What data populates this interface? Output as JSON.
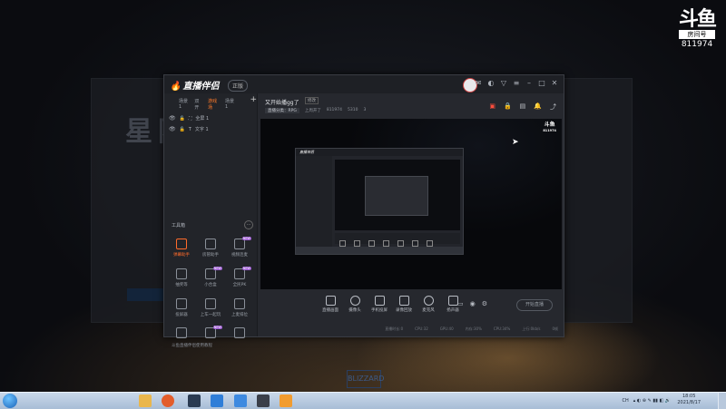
{
  "watermark": {
    "logo": "斗鱼",
    "sub": "房间号",
    "room_id": "811974"
  },
  "desktop": {
    "ghost_title": "星际",
    "blizzard_logo": "BLIZZARD"
  },
  "app": {
    "brand": "直播伴侣",
    "version_badge": "正版",
    "scene_tabs": [
      "场景1",
      "双开",
      "游戏场",
      "场景1"
    ],
    "active_scene": "游戏场",
    "sources": [
      {
        "name": "全屏 1"
      },
      {
        "name": "文字 1"
      }
    ],
    "tools_title": "工具箱",
    "tools": [
      {
        "label": "弹幕助手",
        "icon": "chat-bubble-icon",
        "active": true
      },
      {
        "label": "房管助手",
        "icon": "user-icon",
        "active": false
      },
      {
        "label": "视频连麦",
        "icon": "video-link-icon",
        "active": false,
        "tag": "NEW"
      },
      {
        "label": "抽奖等",
        "icon": "gift-icon",
        "active": false
      },
      {
        "label": "小合盒",
        "icon": "box-icon",
        "active": false,
        "tag": "NEW"
      },
      {
        "label": "全民PK",
        "icon": "pk-shield-icon",
        "active": false,
        "tag": "NEW"
      },
      {
        "label": "投屏器",
        "icon": "cast-icon",
        "active": false
      },
      {
        "label": "上车一起玩",
        "icon": "car-icon",
        "active": false
      },
      {
        "label": "上麦排位",
        "icon": "rank-icon",
        "active": false
      },
      {
        "label": "",
        "icon": "download-icon",
        "active": false
      },
      {
        "label": "",
        "icon": "music-icon",
        "active": false,
        "tag": "NEW"
      },
      {
        "label": "",
        "icon": "stats-icon",
        "active": false
      }
    ],
    "left_footer": "斗鱼直播伴侣使用教程",
    "room": {
      "title": "又开始播gg了",
      "edit_label": "修改",
      "category_label": "直播分类：RPG",
      "meta": [
        "上周开了",
        "811974",
        "5310",
        "3"
      ]
    },
    "controls": [
      {
        "label": "直播画面",
        "icon": "screen-icon"
      },
      {
        "label": "摄像头",
        "icon": "camera-icon"
      },
      {
        "label": "手机投屏",
        "icon": "phone-cast-icon"
      },
      {
        "label": "录像回放",
        "icon": "record-icon"
      },
      {
        "label": "麦克风",
        "icon": "mic-icon"
      },
      {
        "label": "扬声器",
        "icon": "speaker-icon"
      }
    ],
    "start_button": "开始直播",
    "status": [
      "直播时长:0",
      "CPU:32",
      "GPU:40",
      "内存:30%",
      "CPU:34%",
      "上行:0kb/s",
      "0帧"
    ]
  },
  "taskbar": {
    "tray_lang": "CH",
    "clock_time": "18:05",
    "clock_date": "2021/8/17"
  },
  "colors": {
    "accent": "#ff6b2b",
    "brand_flame": "#f3a23a",
    "live": "#ff4d3d"
  }
}
